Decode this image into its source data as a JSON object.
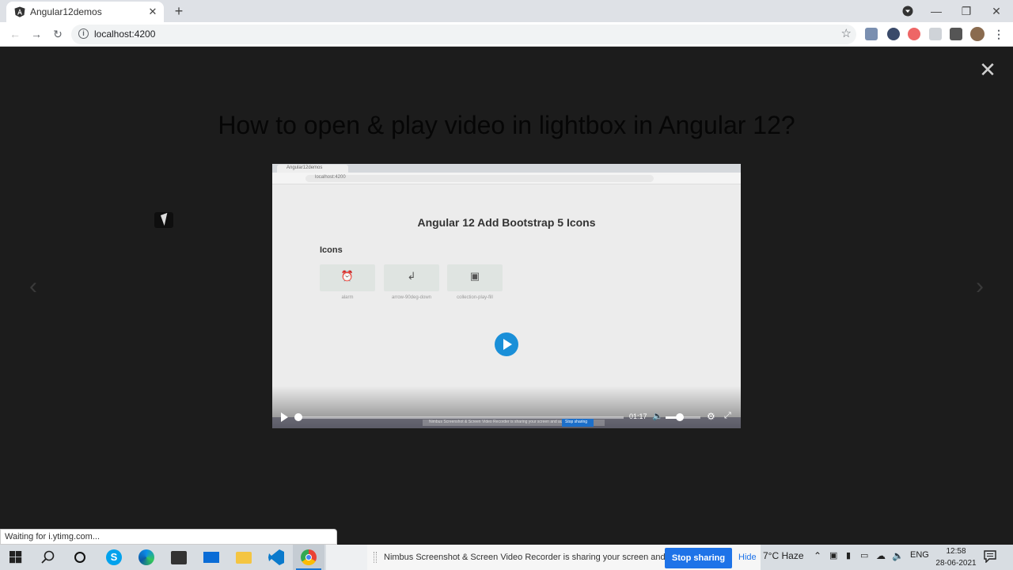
{
  "browser": {
    "tab_title": "Angular12demos",
    "tab_close": "✕",
    "new_tab": "+",
    "url": "localhost:4200",
    "window_controls": {
      "minimize": "—",
      "restore": "❐",
      "close": "✕"
    },
    "nav": {
      "back": "←",
      "forward": "→",
      "reload": "↻"
    }
  },
  "lightbox": {
    "title": "How to open & play video in lightbox in Angular 12?",
    "close_glyph": "✕",
    "prev_glyph": "‹",
    "next_glyph": "›"
  },
  "video": {
    "inner_tab": "Angular12demos",
    "inner_url": "localhost:4200",
    "heading": "Angular 12 Add Bootstrap 5 Icons",
    "subheading": "Icons",
    "icons": [
      {
        "glyph": "⏰",
        "label": "alarm"
      },
      {
        "glyph": "↲",
        "label": "arrow-90deg-down"
      },
      {
        "glyph": "▣",
        "label": "collection-play-fill"
      }
    ],
    "time": "01:17",
    "volume_fraction": 0.4,
    "progress_fraction": 0.0,
    "inner_banner": "Nimbus Screenshot & Screen Video Recorder is sharing your screen and audio.",
    "inner_stop": "Stop sharing"
  },
  "status_text": "Waiting for i.ytimg.com...",
  "taskbar": {
    "sharing_message": "Nimbus Screenshot & Screen Video Recorder is sharing your screen and audio.",
    "stop_sharing": "Stop sharing",
    "hide": "Hide",
    "weather": "7°C  Haze",
    "language": "ENG",
    "time": "12:58",
    "date": "28-06-2021"
  }
}
